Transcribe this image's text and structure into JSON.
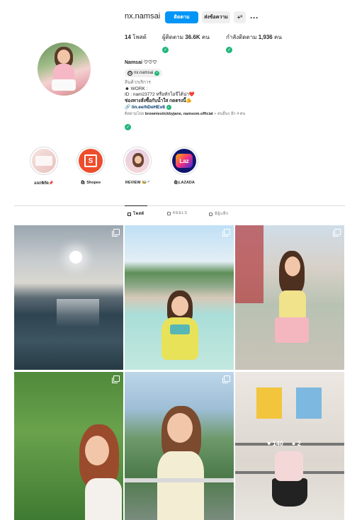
{
  "profile": {
    "username": "nx.namsai",
    "buttons": {
      "follow": "ติดตาม",
      "message": "ส่งข้อความ",
      "add_user": "+",
      "more": "···"
    },
    "stats": {
      "posts_count": "14",
      "posts_label": "โพสต์",
      "followers_label": "ผู้ติดตาม",
      "followers_count": "36.6K",
      "followers_unit": "คน",
      "following_label": "กำลังติดตาม",
      "following_count": "1,936",
      "following_unit": "คน"
    },
    "display_name": "Namsai ♡♡♡",
    "threads_handle": "nx.namsai",
    "bio": {
      "category": "สินค้า/บริการ",
      "line1": "☻ WORK :",
      "line2": "ID : nam23772 หรือทักไอจีได้น่า❤️",
      "line3": "ช่องทางสั่งซื้อกับน้ำใส กดตรงนี้🫵",
      "link": "lin.ee/hDeHEv8",
      "followed_by_prefix": "ติดตามโดย",
      "followed_by_names": "browniestickbyjane, namsom.official",
      "followed_by_suffix": "+ คนอื่นๆ อีก 4 คน"
    }
  },
  "highlights": [
    {
      "label": "แจกพิกัด📌"
    },
    {
      "label": "🛍 Shopee"
    },
    {
      "label": "REVIEW 🐝·ᐟ"
    },
    {
      "label": "🛍LAZADA"
    }
  ],
  "highlight_icons": {
    "shopee": "Shopee bag logo",
    "lazada": "Laz"
  },
  "tabs": [
    {
      "label": "โพสต์",
      "icon": "grid-icon"
    },
    {
      "label": "REELS",
      "icon": "reels-icon"
    },
    {
      "label": "มีผู้แท็ก",
      "icon": "tagged-icon"
    }
  ],
  "grid_overlay": {
    "likes": "140",
    "comments": "2"
  },
  "colors": {
    "accent": "#0095f6",
    "verified": "#20b77a",
    "link": "#00376b",
    "shopee": "#ee4d2d",
    "lazada": "#0f146d"
  }
}
